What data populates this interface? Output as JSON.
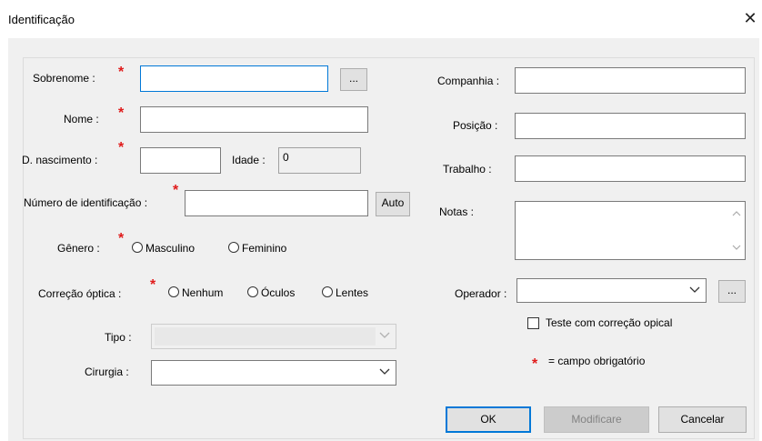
{
  "window": {
    "title": "Identificação",
    "close_glyph": "✕"
  },
  "fields": {
    "sobrenome_label": "Sobrenome :",
    "browse_label": "...",
    "nome_label": "Nome :",
    "nascimento_label": "D. nascimento :",
    "idade_label": "Idade :",
    "idade_value": "0",
    "numero_id_label": "Número de identificação :",
    "auto_label": "Auto",
    "genero_label": "Gênero :",
    "genero_options": [
      "Masculino",
      "Feminino"
    ],
    "correcao_label": "Correção óptica :",
    "correcao_options": [
      "Nenhum",
      "Óculos",
      "Lentes"
    ],
    "tipo_label": "Tipo :",
    "cirurgia_label": "Cirurgia :",
    "companhia_label": "Companhia :",
    "posicao_label": "Posição :",
    "trabalho_label": "Trabalho :",
    "notas_label": "Notas :",
    "operador_label": "Operador :",
    "operador_browse_label": "...",
    "teste_checkbox_label": "Teste com correção opical",
    "required_note": "= campo obrigatório",
    "required_mark": "*"
  },
  "buttons": {
    "ok": "OK",
    "modify": "Modificare",
    "cancel": "Cancelar"
  },
  "colors": {
    "required": "#e01b1b",
    "focus": "#0078d7",
    "dialog_bg": "#f0f0f0"
  }
}
